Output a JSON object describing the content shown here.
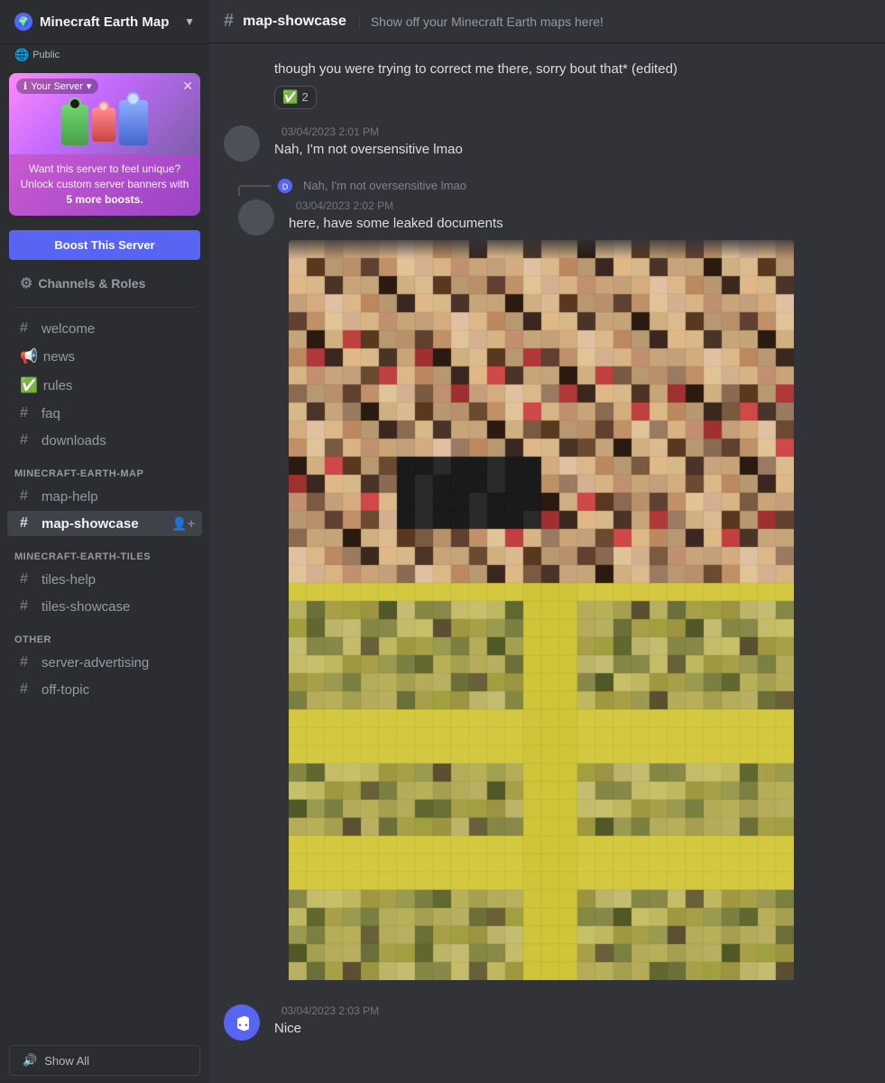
{
  "server": {
    "name": "Minecraft Earth Map",
    "badge": "Public",
    "boost_banner": {
      "your_server_label": "Your Server",
      "description": "Want this server to feel unique? Unlock custom server banners with",
      "boost_highlight": "5 more boosts.",
      "boost_button_label": "Boost This Server"
    }
  },
  "sidebar": {
    "channels_roles_label": "Channels & Roles",
    "channels": [
      {
        "id": "welcome",
        "icon": "#",
        "label": "welcome",
        "type": "text"
      },
      {
        "id": "news",
        "icon": "📢",
        "label": "news",
        "type": "announcement"
      },
      {
        "id": "rules",
        "icon": "✅",
        "label": "rules",
        "type": "rules"
      },
      {
        "id": "faq",
        "icon": "#",
        "label": "faq",
        "type": "text"
      },
      {
        "id": "downloads",
        "icon": "#",
        "label": "downloads",
        "type": "text"
      }
    ],
    "category_minecraft_earth_map": "MINECRAFT-EARTH-MAP",
    "map_channels": [
      {
        "id": "map-help",
        "icon": "#",
        "label": "map-help",
        "type": "text"
      },
      {
        "id": "map-showcase",
        "icon": "#",
        "label": "map-showcase",
        "type": "text",
        "active": true
      }
    ],
    "category_tiles": "MINECRAFT-EARTH-TILES",
    "tiles_channels": [
      {
        "id": "tiles-help",
        "icon": "#",
        "label": "tiles-help",
        "type": "text"
      },
      {
        "id": "tiles-showcase",
        "icon": "#",
        "label": "tiles-showcase",
        "type": "text"
      }
    ],
    "category_other": "OTHER",
    "other_channels": [
      {
        "id": "server-advertising",
        "icon": "#",
        "label": "server-advertising",
        "type": "text"
      },
      {
        "id": "off-topic",
        "icon": "#",
        "label": "off-topic",
        "type": "text"
      }
    ],
    "show_all_label": "Show All"
  },
  "channel_header": {
    "channel_name": "map-showcase",
    "channel_desc": "Show off your Minecraft Earth maps here!"
  },
  "messages": [
    {
      "id": "msg1",
      "type": "continuation",
      "text": "though you were trying to correct me there, sorry bout that*",
      "edited": true,
      "reaction": {
        "emoji": "✅",
        "count": "2"
      }
    },
    {
      "id": "msg2",
      "type": "full",
      "avatar_color": "#4e5058",
      "username": "",
      "timestamp": "03/04/2023 2:01 PM",
      "text": "Nah, I'm not oversensitive lmao"
    },
    {
      "id": "msg3",
      "type": "full_with_reply",
      "avatar_color": "#4e5058",
      "username": "",
      "timestamp": "03/04/2023 2:02 PM",
      "reply_text": "Nah, I'm not oversensitive lmao",
      "text": "here, have some leaked documents",
      "has_image": true
    },
    {
      "id": "msg4",
      "type": "full",
      "avatar_color": "#5865f2",
      "is_discord_bot": false,
      "username": "",
      "timestamp": "03/04/2023 2:03 PM",
      "text": "Nice"
    }
  ]
}
